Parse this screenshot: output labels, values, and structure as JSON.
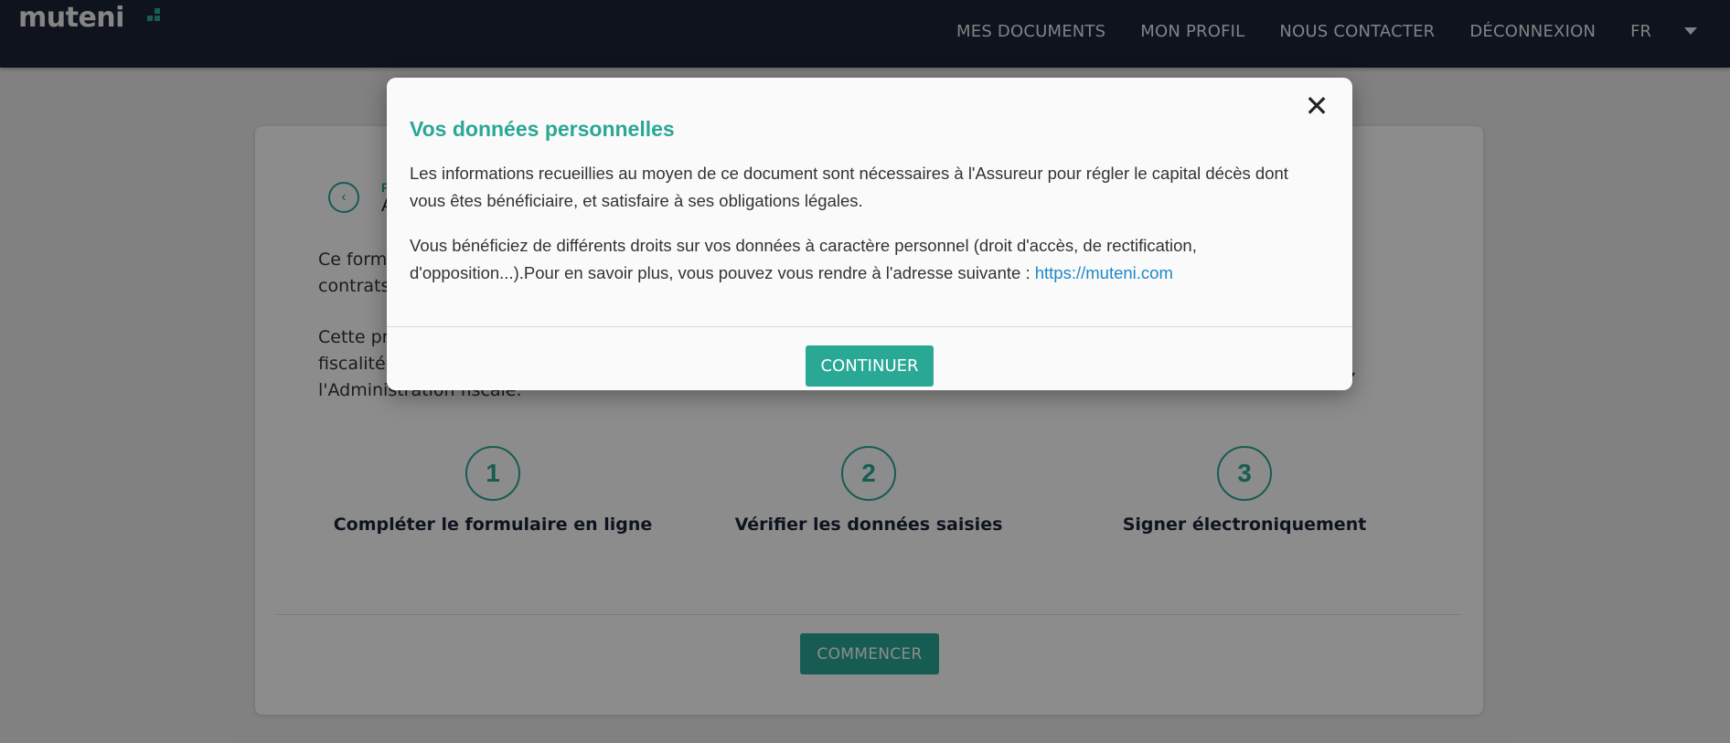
{
  "brand": {
    "logo_text": "muteni",
    "accent": "#2aa896",
    "navbar_bg": "#1b2438"
  },
  "nav": {
    "items": [
      "MES DOCUMENTS",
      "MON PROFIL",
      "NOUS CONTACTER",
      "DÉCONNEXION"
    ],
    "language": "FR"
  },
  "background": {
    "header_small": "F",
    "header_big": "A",
    "intro_line1": "Ce formu",
    "intro_line2": "contrats d",
    "intro2_line1": "Cette pré",
    "intro2_line2": "fiscalité a",
    "intro2_line3": "l'Administration fiscale.",
    "steps": [
      {
        "number": "1",
        "label": "Compléter le formulaire en ligne"
      },
      {
        "number": "2",
        "label": "Vérifier les données saisies"
      },
      {
        "number": "3",
        "label": "Signer électroniquement"
      }
    ],
    "start_button": "COMMENCER"
  },
  "modal": {
    "title": "Vos données personnelles",
    "paragraph1": "Les informations recueillies au moyen de ce document sont nécessaires à l'Assureur pour régler le capital décès dont vous êtes bénéficiaire, et satisfaire à ses obligations légales.",
    "paragraph2_text": "Vous bénéficiez de différents droits sur vos données à caractère personnel (droit d'accès, de rectification, d'opposition...).Pour en savoir plus, vous pouvez vous rendre à l'adresse suivante : ",
    "paragraph2_link": "https://muteni.com",
    "continue_button": "CONTINUER",
    "close_icon": "close-icon"
  }
}
